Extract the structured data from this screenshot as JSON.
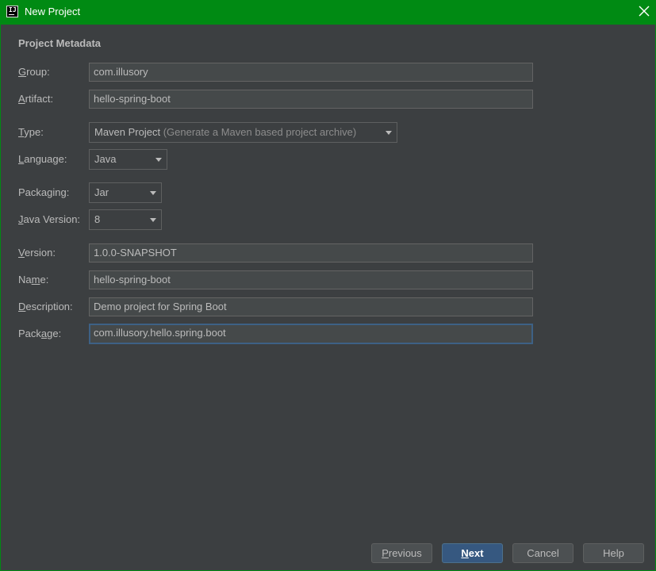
{
  "window": {
    "title": "New Project",
    "app_icon_text": "IJ"
  },
  "section": {
    "title": "Project Metadata"
  },
  "fields": {
    "group": {
      "label_ul": "G",
      "label_rest": "roup:",
      "value": "com.illusory"
    },
    "artifact": {
      "label_ul": "A",
      "label_rest": "rtifact:",
      "value": "hello-spring-boot"
    },
    "type": {
      "label_ul": "T",
      "label_rest": "ype:",
      "value": "Maven Project",
      "hint": "(Generate a Maven based project archive)"
    },
    "language": {
      "label_pre": "",
      "label_ul": "L",
      "label_rest": "anguage:",
      "value": "Java"
    },
    "packaging": {
      "label_pre": "Packa",
      "label_ul": "g",
      "label_rest": "ing:",
      "value": "Jar"
    },
    "java_version": {
      "label_ul": "J",
      "label_rest": "ava Version:",
      "value": "8"
    },
    "version": {
      "label_ul": "V",
      "label_rest": "ersion:",
      "value": "1.0.0-SNAPSHOT"
    },
    "name": {
      "label_pre": "Na",
      "label_ul": "m",
      "label_rest": "e:",
      "value": "hello-spring-boot"
    },
    "description": {
      "label_ul": "D",
      "label_rest": "escription:",
      "value": "Demo project for Spring Boot"
    },
    "package": {
      "label_pre": "Pack",
      "label_ul": "a",
      "label_rest": "ge:",
      "value": "com.illusory.hello.spring.boot"
    }
  },
  "buttons": {
    "previous": {
      "ul": "P",
      "rest": "revious"
    },
    "next": {
      "ul": "N",
      "rest": "ext"
    },
    "cancel": "Cancel",
    "help": "Help"
  },
  "colors": {
    "titlebar": "#008a13",
    "background": "#3c3f41",
    "primary_button": "#365880",
    "focus_border": "#3d6185"
  }
}
